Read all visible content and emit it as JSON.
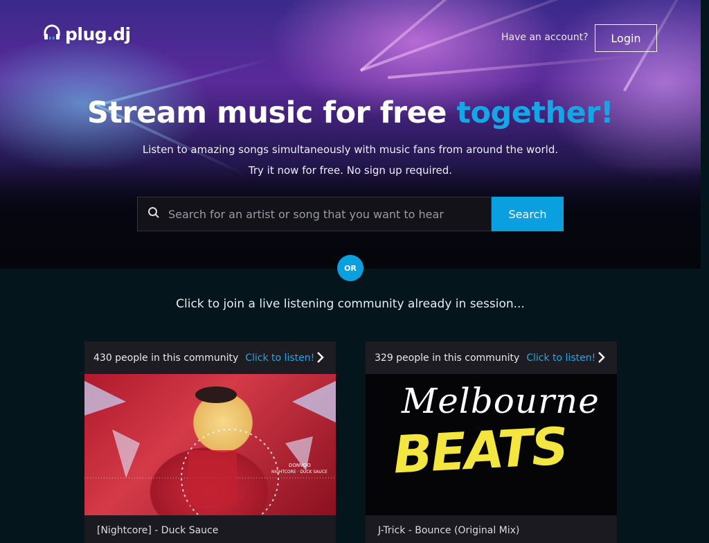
{
  "brand": {
    "logo_text": "plug.dj"
  },
  "header": {
    "account_prompt": "Have an account?",
    "login_label": "Login"
  },
  "hero": {
    "headline_main": "Stream music for free ",
    "headline_accent": "together!",
    "subtitle_1": "Listen to amazing songs simultaneously with music fans from around the world.",
    "subtitle_2": "Try it now for free. No sign up required."
  },
  "search": {
    "placeholder": "Search for an artist or song that you want to hear",
    "button_label": "Search"
  },
  "divider": {
    "or_label": "OR"
  },
  "communities": {
    "heading": "Click to join a live listening community already in session...",
    "cards": [
      {
        "count_text": "430 people in this community",
        "listen_label": "Click to listen!",
        "art_text_1": "DONVOO",
        "art_text_2": "NIGHTCORE · DUCK SAUCE",
        "now_playing": "[Nightcore] - Duck Sauce"
      },
      {
        "count_text": "329 people in this community",
        "listen_label": "Click to listen!",
        "art_text_1": "Melbourne",
        "art_text_2": "BEATS",
        "now_playing": "J-Trick - Bounce (Original Mix)"
      }
    ]
  },
  "colors": {
    "accent": "#0aa0e0",
    "background": "#04161c",
    "card_header": "#1c1c22"
  },
  "icons": [
    "headphones-logo-icon",
    "search-icon",
    "chevron-right-icon"
  ]
}
